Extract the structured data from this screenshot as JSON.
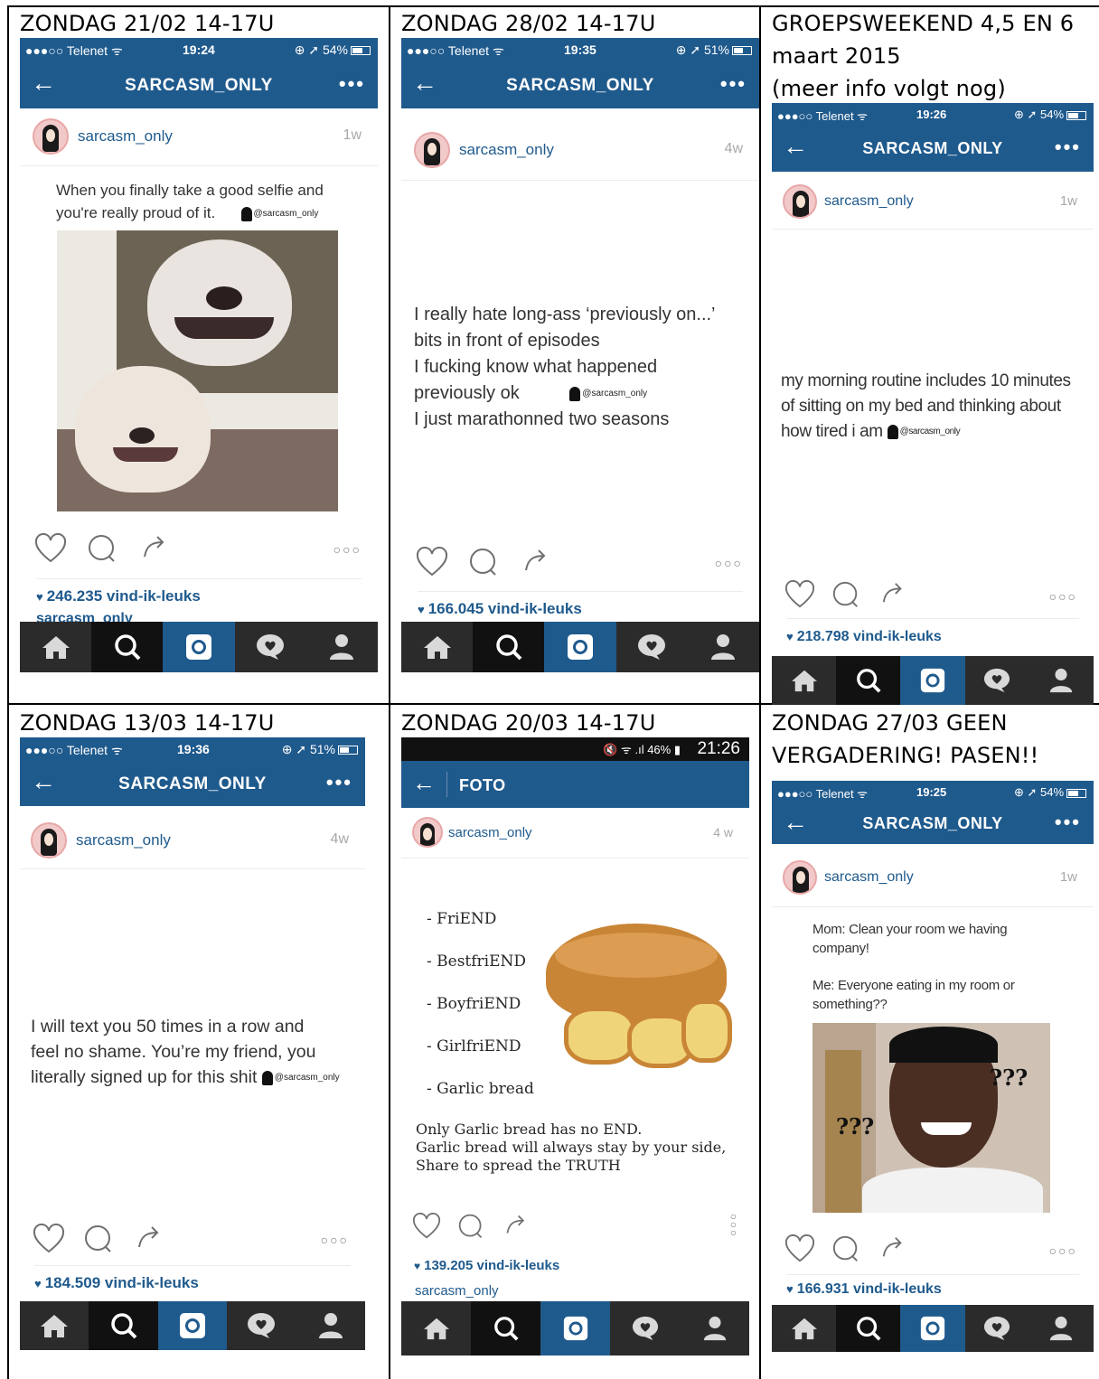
{
  "grid": {
    "captions": [
      "ZONDAG 21/02 14-17U",
      "ZONDAG 28/02 14-17U",
      [
        "GROEPSWEEKEND 4,5 EN 6",
        "maart 2015",
        "(meer info volgt nog)"
      ],
      "ZONDAG 13/03 14-17U",
      "ZONDAG 20/03 14-17U",
      [
        "ZONDAG 27/03 GEEN",
        "VERGADERING! PASEN!!"
      ]
    ]
  },
  "phones": [
    {
      "status": {
        "carrier": "●●●○○ Telenet ᯤ",
        "time": "19:24",
        "battery": "⊕ ➚ 54%"
      },
      "nav": {
        "back": "←",
        "title": "SARCASM_ONLY",
        "more": "•••"
      },
      "user": "sarcasm_only",
      "ago": "1w",
      "text_lines": [
        "When you finally take a good selfie and",
        "you're really proud of it."
      ],
      "watermark": "@sarcasm_only",
      "likes": "246.235 vind-ik-leuks",
      "caption_user": "sarcasm_only"
    },
    {
      "status": {
        "carrier": "●●●○○ Telenet ᯤ",
        "time": "19:35",
        "battery": "⊕ ➚ 51%"
      },
      "nav": {
        "back": "←",
        "title": "SARCASM_ONLY",
        "more": "•••"
      },
      "user": "sarcasm_only",
      "ago": "4w",
      "text_lines": [
        "I really hate long-ass ‘previously on...’",
        "bits in front of episodes",
        "I fucking know what happened",
        "previously ok",
        "I just marathonned two seasons"
      ],
      "watermark": "@sarcasm_only",
      "likes": "166.045 vind-ik-leuks"
    },
    {
      "status": {
        "carrier": "●●●○○ Telenet ᯤ",
        "time": "19:26",
        "battery": "⊕ ➚ 54%"
      },
      "nav": {
        "back": "←",
        "title": "SARCASM_ONLY",
        "more": "•••"
      },
      "user": "sarcasm_only",
      "ago": "1w",
      "text_lines": [
        "my morning routine includes 10 minutes",
        "of sitting on my bed and thinking about",
        "how tired i am"
      ],
      "watermark": "@sarcasm_only",
      "likes": "218.798 vind-ik-leuks"
    },
    {
      "status": {
        "carrier": "●●●○○ Telenet ᯤ",
        "time": "19:36",
        "battery": "⊕ ➚ 51%"
      },
      "nav": {
        "back": "←",
        "title": "SARCASM_ONLY",
        "more": "•••"
      },
      "user": "sarcasm_only",
      "ago": "4w",
      "text_lines": [
        "I will text you 50 times in a row and",
        "feel no shame. You’re my friend, you",
        "literally signed up for this shit"
      ],
      "watermark": "@sarcasm_only",
      "likes": "184.509 vind-ik-leuks"
    },
    {
      "status": {
        "icons": "🔇 ᯤ .ıl 46% ▮",
        "time": "21:26"
      },
      "nav": {
        "back": "←",
        "title": "FOTO"
      },
      "user": "sarcasm_only",
      "ago": "4 w",
      "list": [
        "- FriEND",
        "- BestfriEND",
        "- BoyfriEND",
        "- GirlfriEND",
        "- Garlic bread"
      ],
      "footer_lines": [
        "Only Garlic bread has no END.",
        "Garlic bread will always stay by your side,",
        "Share to spread the TRUTH"
      ],
      "likes": "139.205 vind-ik-leuks",
      "caption_user": "sarcasm_only"
    },
    {
      "status": {
        "carrier": "●●●○○ Telenet ᯤ",
        "time": "19:25",
        "battery": "⊕ ➚ 54%"
      },
      "nav": {
        "back": "←",
        "title": "SARCASM_ONLY",
        "more": "•••"
      },
      "user": "sarcasm_only",
      "ago": "1w",
      "text_lines": [
        "Mom: Clean your room we having",
        "company!",
        "",
        "Me: Everyone eating in my room or",
        "something??"
      ],
      "meme_marks": [
        "???",
        "???"
      ],
      "likes": "166.931 vind-ik-leuks"
    }
  ],
  "colors": {
    "accent": "#1f5a8d",
    "tabbar": "#2b2b2b",
    "tab_active_dark": "#111111"
  }
}
